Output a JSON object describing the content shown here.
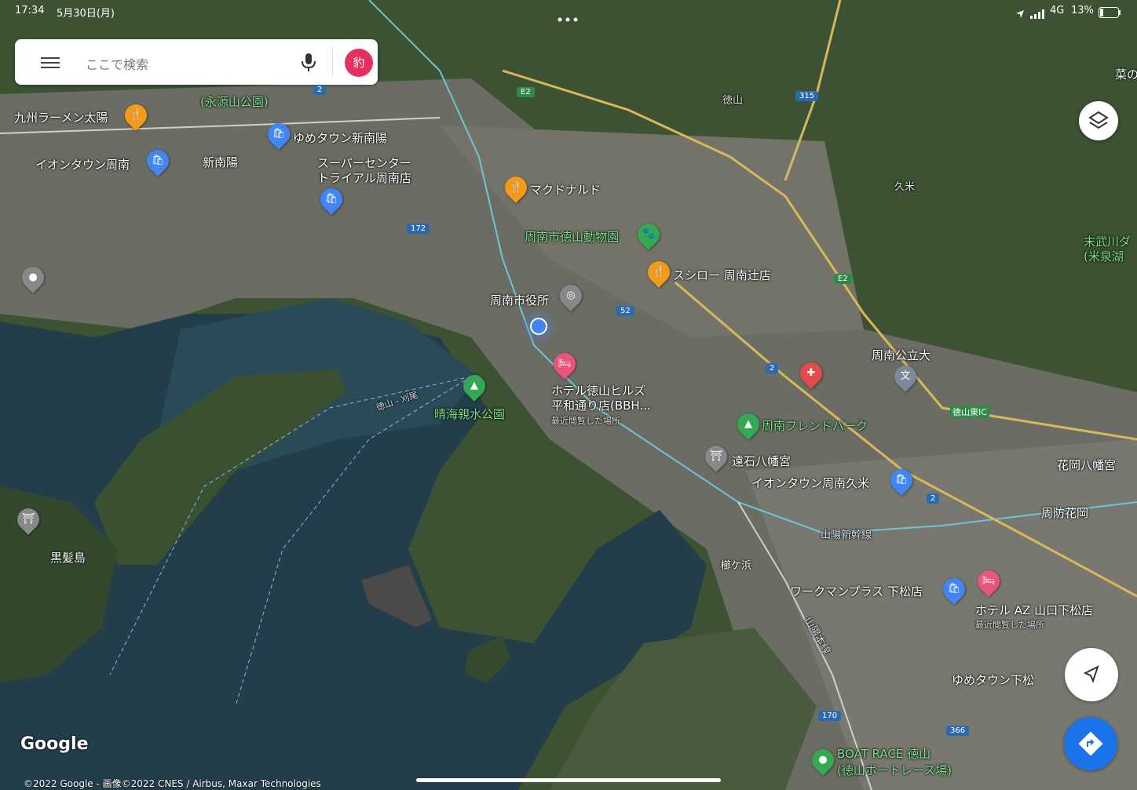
{
  "status_bar": {
    "time": "17:34",
    "date": "5月30日(月)",
    "network": "4G",
    "battery": "13%"
  },
  "search": {
    "placeholder": "ここで検索",
    "avatar_initial": "豹"
  },
  "attribution": {
    "logo": "Google",
    "copyright": "©2022 Google - 画像©2022 CNES / Airbus, Maxar Technologies"
  },
  "labels": {
    "kyushu_ramen": "九州ラーメン太陽",
    "eikokuzan_park": "(永源山公園)",
    "youme_shinnanyo": "ゆめタウン新南陽",
    "aeon_shunan": "イオンタウン周南",
    "shinnanyo_station": "新南陽",
    "super_center_1": "スーパーセンター",
    "super_center_2": "トライアル周南店",
    "mcdonalds": "マクドナルド",
    "tokuyama_zoo": "周南市徳山動物園",
    "sushiro": "スシロー 周南辻店",
    "city_hall": "周南市役所",
    "hotel_hills_1": "ホテル徳山ヒルズ",
    "hotel_hills_2": "平和通り店(BBH...",
    "recently_viewed": "最近閲覧した場所",
    "seikai_park": "晴海親水公園",
    "ferry_route": "徳山 - 刈尾",
    "tokuyama": "徳山",
    "kume": "久米",
    "shunan_univ": "周南公立大",
    "tokuyama_east_ic": "徳山東IC",
    "friend_park": "周南フレンドパーク",
    "toishi_hachiman": "遠石八幡宮",
    "aeon_kume": "イオンタウン周南久米",
    "hanaoka_hachiman": "花岡八幡宮",
    "suo_hanaoka": "周防花岡",
    "sanyo_shinkansen": "山陽新幹線",
    "kushigahama": "櫛ケ浜",
    "workman": "ワークマンプラス 下松店",
    "hotel_az": "ホテル AZ 山口下松店",
    "recently_viewed_2": "最近閲覧した場所",
    "sanyo_main_line": "山陽本線",
    "youme_kudamatsu": "ゆめタウン下松",
    "boat_race_1": "BOAT RACE 徳山",
    "boat_race_2": "(徳山ボートレース場)",
    "kurokami_island": "黒髪島",
    "suemutake_1": "末武川ダ",
    "suemutake_2": "(米泉湖",
    "na": "菜の"
  },
  "road_shields": [
    "2",
    "E2",
    "315",
    "172",
    "52",
    "2",
    "E2",
    "2",
    "170",
    "366"
  ],
  "colors": {
    "water": "#233e4a",
    "forest": "#3c5233",
    "urban": "#6b6c63",
    "food_poi": "#f29b1b",
    "shop_poi": "#4285f4",
    "park_poi": "#34a853",
    "hotel_poi": "#e8547a",
    "location_dot": "#4285f4",
    "directions_button": "#1a73e8"
  }
}
